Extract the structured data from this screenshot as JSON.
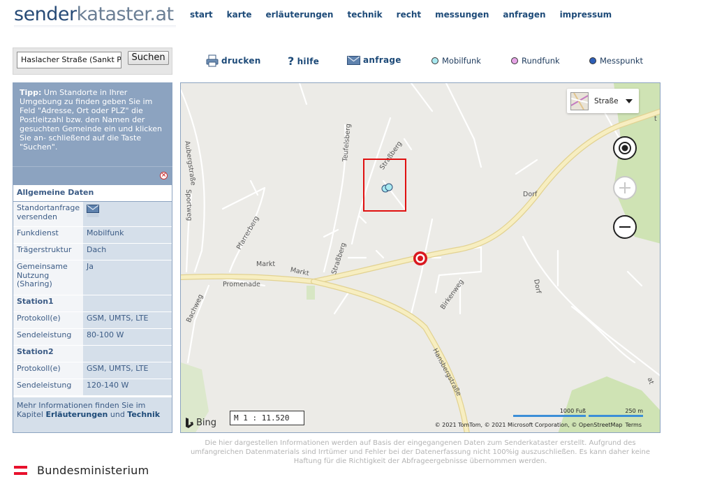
{
  "header": {
    "logo_part1": "sender",
    "logo_part2": "kataster.at",
    "nav": [
      "start",
      "karte",
      "erläuterungen",
      "technik",
      "recht",
      "messungen",
      "anfragen",
      "impressum"
    ]
  },
  "search": {
    "value": "Haslacher Straße (Sankt Pet",
    "button_label": "Suchen"
  },
  "toolbar": {
    "print_label": "drucken",
    "help_label": "hilfe",
    "request_label": "anfrage"
  },
  "legend": [
    {
      "label": "Mobilfunk",
      "color": "#a9e9f0"
    },
    {
      "label": "Rundfunk",
      "color": "#e6a4e6"
    },
    {
      "label": "Messpunkt",
      "color": "#2e5fb8"
    }
  ],
  "tip": {
    "bold": "Tipp:",
    "text": " Um Standorte in Ihrer Umgebung zu finden geben Sie im Feld \"Adresse, Ort oder PLZ\" die Postleitzahl bzw. den Namen der gesuchten Gemeinde ein und klicken Sie an- schließend auf die Taste \"Suchen\"."
  },
  "details": {
    "heading": "Allgemeine Daten",
    "request_label": "Standortanfrage versenden",
    "service_key": "Funkdienst",
    "service_value": "Mobilfunk",
    "structure_key": "Trägerstruktur",
    "structure_value": "Dach",
    "sharing_key": "Gemeinsame Nutzung (Sharing)",
    "sharing_value": "Ja",
    "station1": "Station1",
    "station1_protocol_key": "Protokoll(e)",
    "station1_protocol_value": "GSM, UMTS, LTE",
    "station1_power_key": "Sendeleistung",
    "station1_power_value": "80-100 W",
    "station2": "Station2",
    "station2_protocol_key": "Protokoll(e)",
    "station2_protocol_value": "GSM, UMTS, LTE",
    "station2_power_key": "Sendeleistung",
    "station2_power_value": "120-140 W",
    "more_text": "Mehr Informationen finden Sie im Kapitel ",
    "more_link1": "Erläuterungen",
    "more_and": " und ",
    "more_link2": "Technik"
  },
  "map": {
    "style_label": "Straße",
    "scale_label": "M 1 : 11.520",
    "bing_label": "Bing",
    "copyright": "© 2021 TomTom, © 2021 Microsoft Corporation, © OpenStreetMap",
    "terms": "Terms",
    "scale_feet": "1000 Fuß",
    "scale_m": "250 m",
    "streets": {
      "aubergstrasse": "Aubergstraße",
      "sportweg": "Sportweg",
      "pfarrerberg": "Pfarrerberg",
      "teufelsberg": "Teufelsberg",
      "strassberg_top": "Straßberg",
      "strassberg": "Straßberg",
      "markt1": "Markt",
      "markt2": "Markt",
      "promenade": "Promenade",
      "bachweg": "Bachweg",
      "dorf1": "Dorf",
      "dorf2": "Dorf",
      "birkenweg": "Birkenweg",
      "hansbergstrasse": "Hansbergstraße",
      "edge_t": "t",
      "edge_at": "at"
    }
  },
  "disclaimer": "Die hier dargestellen Informationen werden auf Basis der eingegangenen Daten zum Senderkataster erstellt. Aufgrund des umfangreichen Datenmaterials sind Irrtümer und Fehler bei der Datenerfassung nicht 100%ig auszuschließen. Es kann daher keine Haftung für die Richtigkeit der Abfrageergebnisse übernommen werden.",
  "footer": {
    "ministry": "Bundesministerium",
    "flag_colors": [
      "#e8112d",
      "#ffffff",
      "#e8112d"
    ]
  }
}
